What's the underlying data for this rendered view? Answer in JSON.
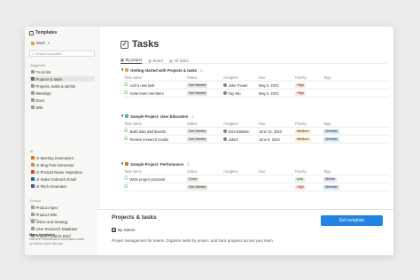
{
  "sidebar": {
    "title": "Templates",
    "workspace": "Work",
    "search_placeholder": "Search templates",
    "suggested_label": "Suggested",
    "suggested": [
      {
        "label": "To-do list",
        "color": "#9a9a97"
      },
      {
        "label": "Projects & tasks",
        "color": "#6b6b69"
      },
      {
        "label": "Projects, tasks & sprints",
        "color": "#9a9a97"
      },
      {
        "label": "Meetings",
        "color": "#9a9a97"
      },
      {
        "label": "Docs",
        "color": "#9a9a97"
      },
      {
        "label": "Wiki",
        "color": "#9a9a97"
      }
    ],
    "ai_label": "AI",
    "ai": [
      {
        "label": "AI Meeting Summaries",
        "color": "#d9730d"
      },
      {
        "label": "AI Blog Post Generator",
        "color": "#cb912f"
      },
      {
        "label": "AI Product Name Inspiration",
        "color": "#e03e3e"
      },
      {
        "label": "AI Sales Outreach Email",
        "color": "#0b6e99"
      },
      {
        "label": "AI Pitch Generator",
        "color": "#6940a5"
      }
    ],
    "product_label": "Product",
    "product": [
      {
        "label": "Product Spec",
        "color": "#9a9a97"
      },
      {
        "label": "Product Wiki",
        "color": "#9a9a97"
      },
      {
        "label": "Vision and Strategy",
        "color": "#9a9a97"
      },
      {
        "label": "User Research Database",
        "color": "#9a9a97"
      },
      {
        "label": "Product Launch Brief",
        "color": "#9a9a97"
      }
    ],
    "more_link": "More...",
    "more_title": "More templates",
    "more_desc_1": "Discover thousands of templates made",
    "more_desc_2": "by Notion users like you"
  },
  "page": {
    "title": "Tasks",
    "views": [
      {
        "label": "By project",
        "icon": "grid-icon"
      },
      {
        "label": "Board",
        "icon": "board-icon"
      },
      {
        "label": "All Tasks",
        "icon": "table-icon"
      }
    ]
  },
  "columns": {
    "task": "Task name",
    "status": "Status",
    "assignee": "Assignee",
    "due": "Due",
    "priority": "Priority",
    "tags": "Tags"
  },
  "groups": [
    {
      "title": "Getting started with Projects & tasks",
      "count": "2",
      "color": "#e0a437",
      "rows": [
        {
          "task": "Add a new task",
          "status": "Not Started",
          "assignee": "Jake Trower",
          "due": "May 6, 2023",
          "priority": "High",
          "tags": ""
        },
        {
          "task": "Invite team members",
          "status": "Not Started",
          "assignee": "Fay Wu",
          "due": "May 6, 2023",
          "priority": "High",
          "tags": ""
        }
      ]
    },
    {
      "title": "Sample Project: User Education",
      "count": "2",
      "color": "#4dab9a",
      "rows": [
        {
          "task": "Build data dashboards",
          "status": "Not Started",
          "assignee": "Sam Baldwin",
          "due": "June 13, 2023",
          "priority": "Medium",
          "tags": "Website"
        },
        {
          "task": "Review research results",
          "status": "Not Started",
          "assignee": "Jake3",
          "due": "June 8, 2023",
          "priority": "Medium",
          "tags": "Website"
        }
      ]
    },
    {
      "title": "Sample Project: Performance",
      "count": "3",
      "color": "#d9730d",
      "rows": [
        {
          "task": "Write project proposal",
          "status": "Done",
          "assignee": "",
          "due": "",
          "priority": "Low",
          "tags": "Mobile"
        },
        {
          "task": "",
          "status": "Not Started",
          "assignee": "",
          "due": "",
          "priority": "High",
          "tags": "Website"
        }
      ]
    }
  ],
  "footer": {
    "title": "Projects & tasks",
    "author": "By Notion",
    "description": "Project management for teams. Organize tasks by project, and track progress across your team.",
    "button": "Get template"
  }
}
